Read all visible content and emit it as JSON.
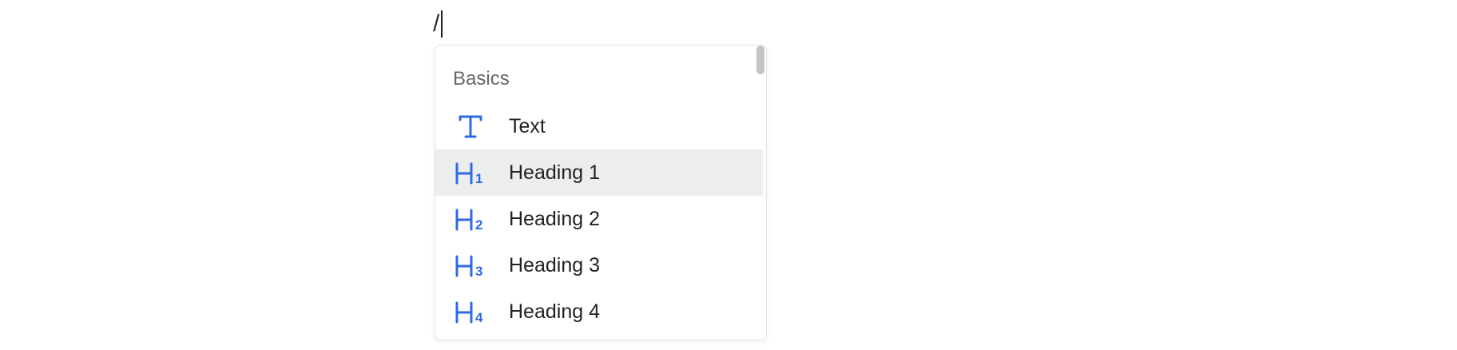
{
  "editor": {
    "typed_text": "/"
  },
  "slash_menu": {
    "section_title": "Basics",
    "accent_color": "#2f6ae5",
    "highlight_color": "#eceeee",
    "items": [
      {
        "label": "Text",
        "icon": "text-type-icon",
        "highlighted": false
      },
      {
        "label": "Heading 1",
        "icon": "heading-1-icon",
        "highlighted": true
      },
      {
        "label": "Heading 2",
        "icon": "heading-2-icon",
        "highlighted": false
      },
      {
        "label": "Heading 3",
        "icon": "heading-3-icon",
        "highlighted": false
      },
      {
        "label": "Heading 4",
        "icon": "heading-4-icon",
        "highlighted": false
      }
    ]
  }
}
